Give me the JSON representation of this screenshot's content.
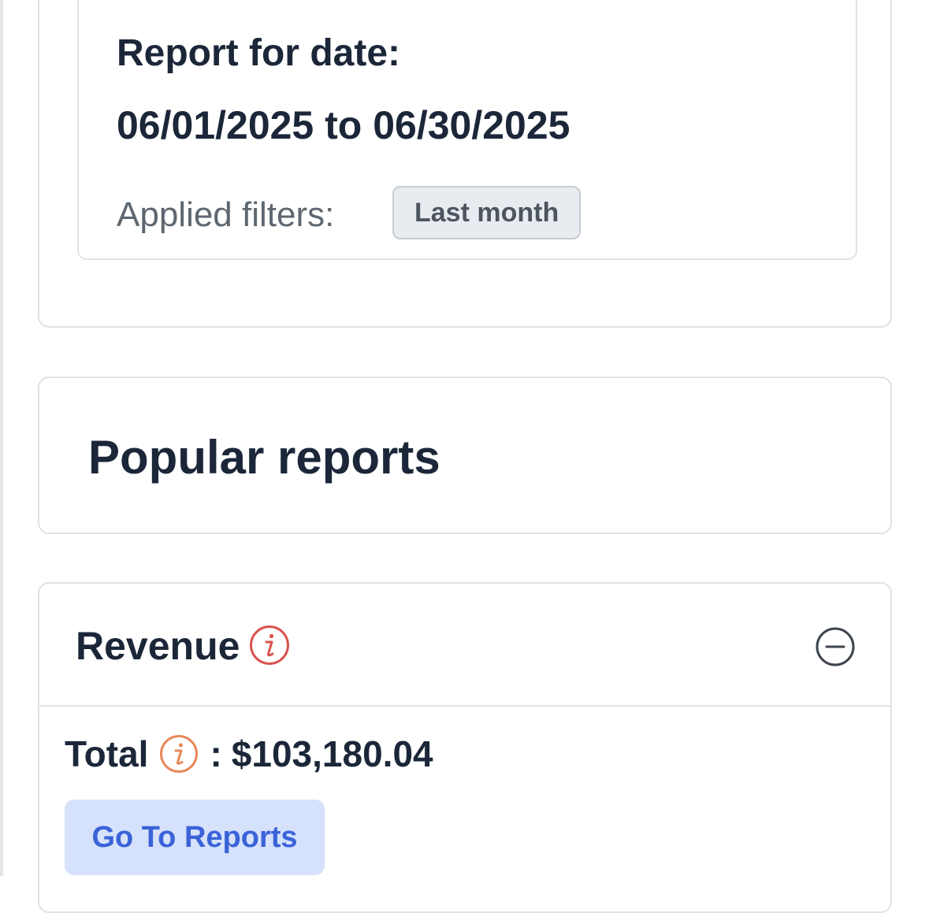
{
  "report_card": {
    "title": "Report for date:",
    "date_range": "06/01/2025 to 06/30/2025",
    "filters_label": "Applied filters:",
    "filter_chip": "Last month"
  },
  "popular_reports": {
    "title": "Popular reports"
  },
  "revenue_card": {
    "title": "Revenue",
    "title_info_icon": "info-icon",
    "collapse_icon": "minus-circle-icon",
    "total_label": "Total",
    "total_info_icon": "info-icon",
    "total_separator": ":",
    "total_value": "$103,180.04",
    "go_to_reports_label": "Go To Reports"
  },
  "colors": {
    "text_primary": "#1b2739",
    "text_muted": "#5e6670",
    "border": "#dfe2e6",
    "chip_bg": "#e8ebf0",
    "info_red": "#d9534f",
    "info_orange": "#e8875a",
    "button_bg": "#d6e1fb",
    "button_text": "#3a63d8"
  }
}
